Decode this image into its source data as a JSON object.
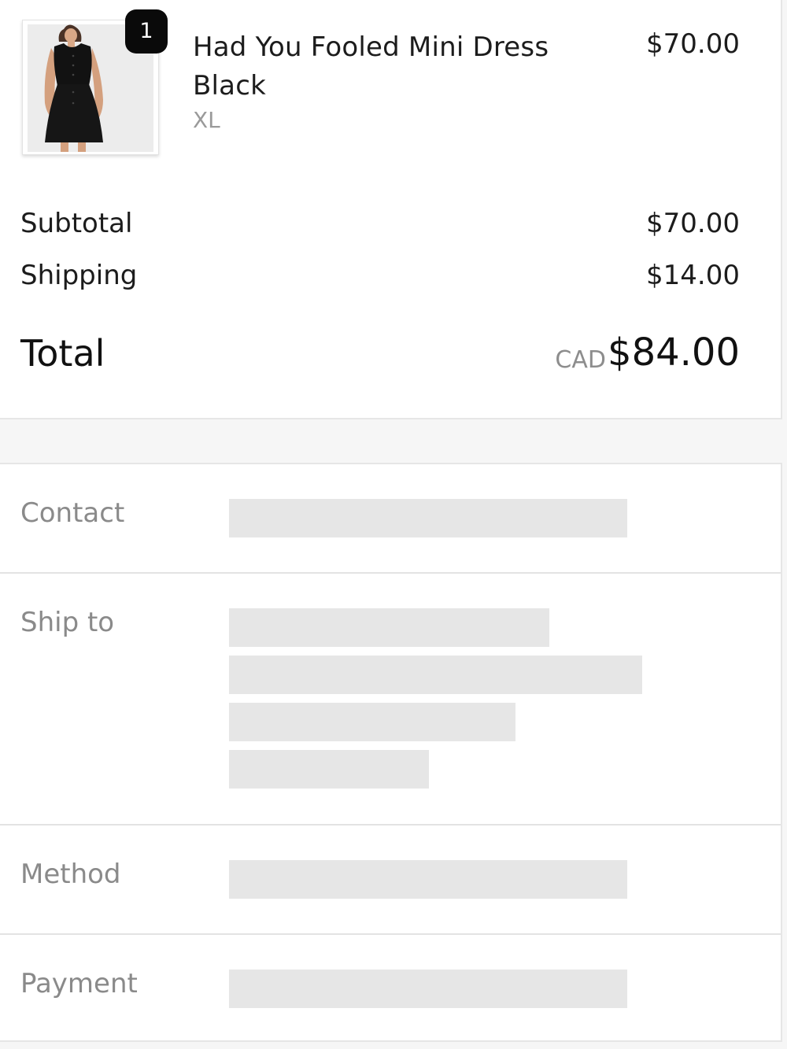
{
  "order_summary": {
    "item": {
      "name": "Had You Fooled Mini Dress Black",
      "variant": "XL",
      "price": "$70.00",
      "quantity": "1",
      "image": "dress-photo"
    },
    "subtotal_label": "Subtotal",
    "subtotal_value": "$70.00",
    "shipping_label": "Shipping",
    "shipping_value": "$14.00",
    "total_label": "Total",
    "total_currency": "CAD",
    "total_value": "$84.00"
  },
  "review": {
    "contact_label": "Contact",
    "ship_to_label": "Ship to",
    "method_label": "Method",
    "payment_label": "Payment"
  },
  "colors": {
    "badge": "#0a0a0a",
    "redaction": "#e6e6e6",
    "muted_text": "#8a8a8a"
  }
}
